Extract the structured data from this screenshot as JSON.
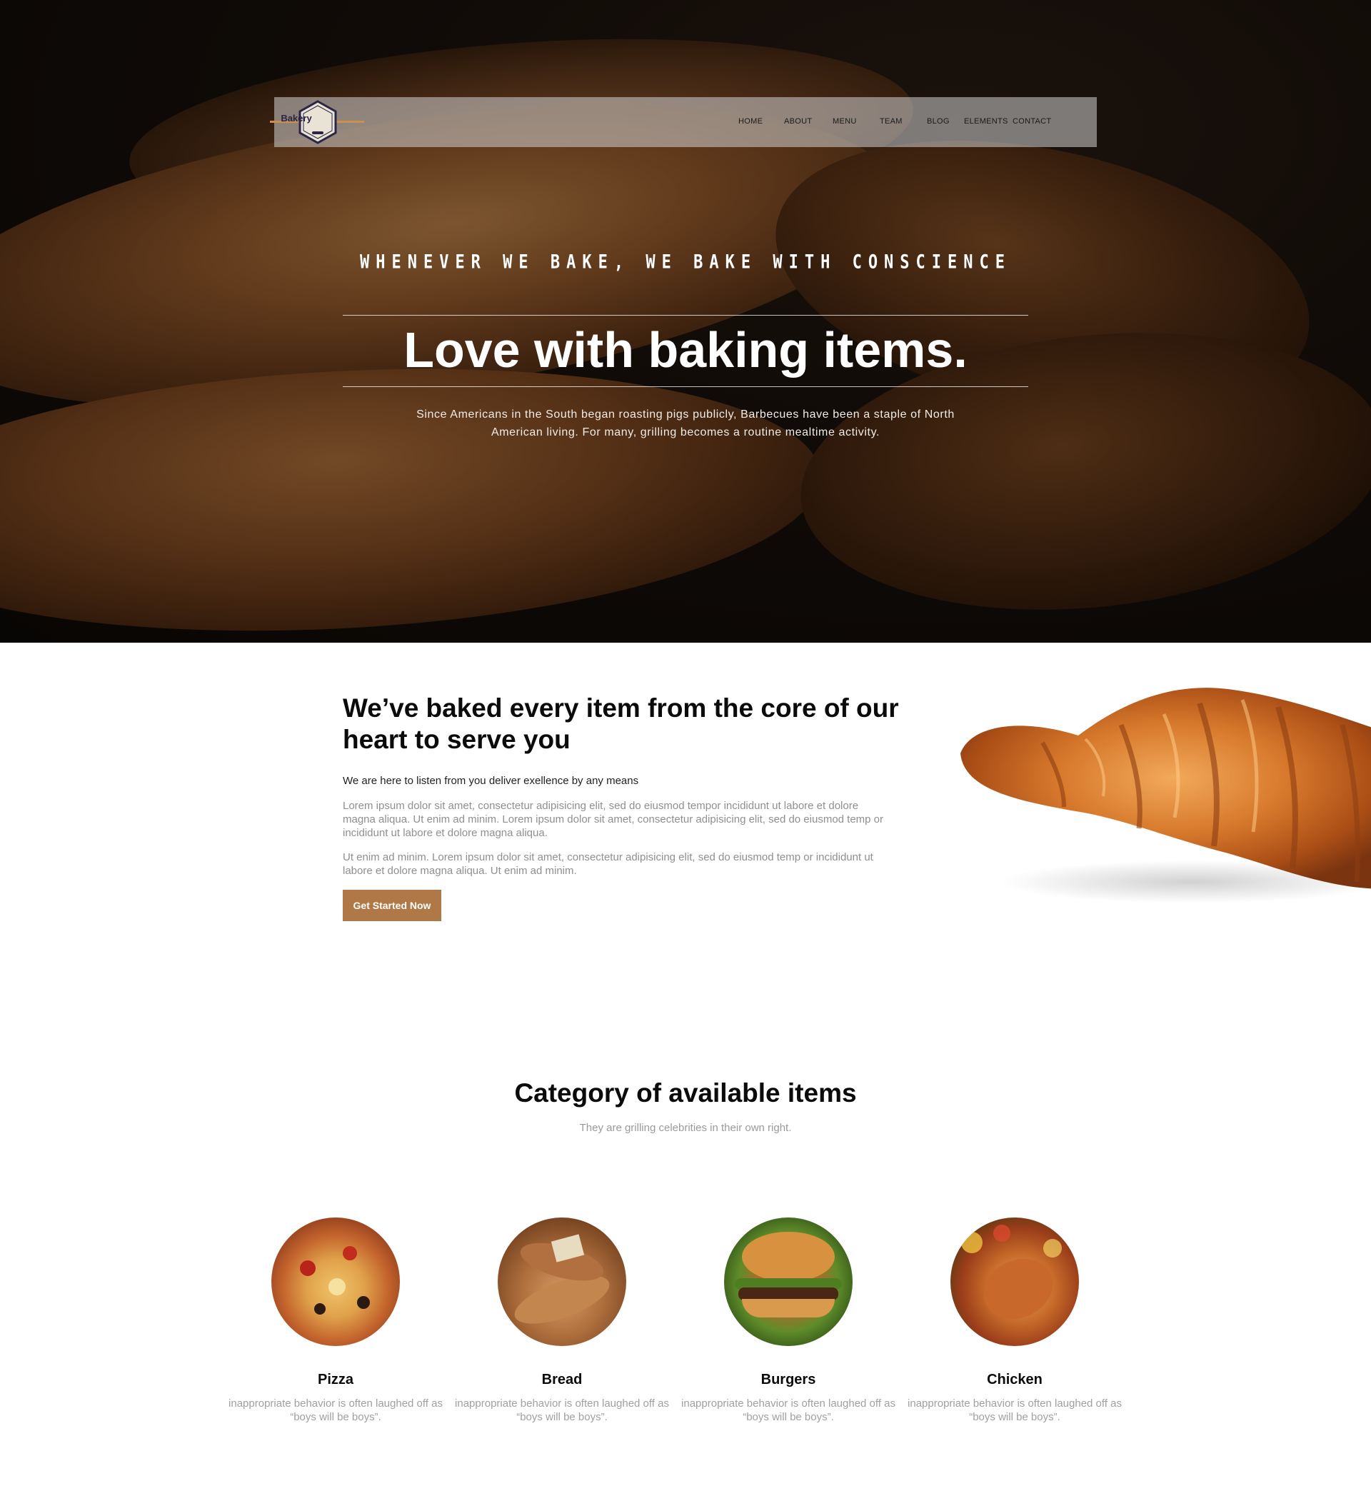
{
  "brand": {
    "logo_text": "Bakery",
    "accent_color": "#b07846"
  },
  "nav": {
    "items": [
      {
        "label": "HOME"
      },
      {
        "label": "ABOUT"
      },
      {
        "label": "MENU"
      },
      {
        "label": "TEAM"
      },
      {
        "label": "BLOG"
      },
      {
        "label": "ELEMENTS"
      },
      {
        "label": "CONTACT"
      }
    ]
  },
  "hero": {
    "tagline": "WHENEVER WE BAKE, WE BAKE WITH CONSCIENCE",
    "title": "Love with baking items.",
    "description": "Since Americans in the South began roasting pigs publicly, Barbecues have been a staple of North American living. For many, grilling becomes a routine mealtime activity."
  },
  "about": {
    "heading": "We’ve baked every item from the core of our heart to serve you",
    "subheading": "We are here to listen from you deliver exellence by any means",
    "paragraph1": "Lorem ipsum dolor sit amet, consectetur adipisicing elit, sed do eiusmod tempor incididunt ut labore et dolore magna aliqua. Ut enim ad minim. Lorem ipsum dolor sit amet, consectetur adipisicing elit, sed do eiusmod temp or incididunt ut labore et dolore magna aliqua.",
    "paragraph2": "Ut enim ad minim. Lorem ipsum dolor sit amet, consectetur adipisicing elit, sed do eiusmod temp or incididunt ut labore et dolore magna aliqua. Ut enim ad minim.",
    "cta_label": "Get Started Now"
  },
  "categories": {
    "title": "Category of available items",
    "subtitle": "They are grilling celebrities in their own right.",
    "items": [
      {
        "name": "Pizza",
        "description": "inappropriate behavior is often laughed off as “boys will be boys”."
      },
      {
        "name": "Bread",
        "description": "inappropriate behavior is often laughed off as “boys will be boys”."
      },
      {
        "name": "Burgers",
        "description": "inappropriate behavior is often laughed off as “boys will be boys”."
      },
      {
        "name": "Chicken",
        "description": "inappropriate behavior is often laughed off as “boys will be boys”."
      }
    ]
  }
}
